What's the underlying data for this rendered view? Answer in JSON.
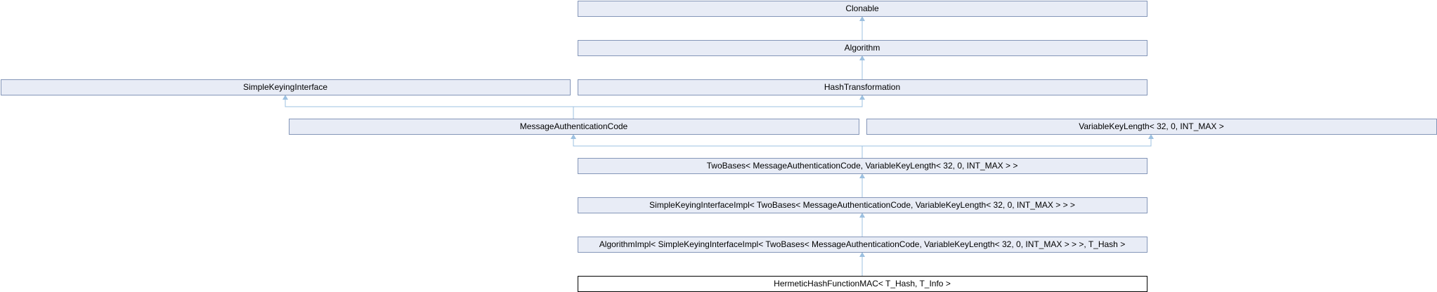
{
  "diagram": {
    "type": "class-inheritance-graph",
    "colors": {
      "base_fill": "#e8ecf6",
      "base_border": "#8496b8",
      "leaf_fill": "#ffffff",
      "leaf_border": "#000000",
      "edge": "#9cc0e0"
    },
    "nodes": [
      {
        "id": "clonable",
        "label": "Clonable",
        "kind": "base"
      },
      {
        "id": "algorithm",
        "label": "Algorithm",
        "kind": "base"
      },
      {
        "id": "simple-keying-interface",
        "label": "SimpleKeyingInterface",
        "kind": "base"
      },
      {
        "id": "hash-transformation",
        "label": "HashTransformation",
        "kind": "base"
      },
      {
        "id": "message-authentication-code",
        "label": "MessageAuthenticationCode",
        "kind": "base"
      },
      {
        "id": "variable-key-length",
        "label": "VariableKeyLength< 32, 0, INT_MAX >",
        "kind": "base"
      },
      {
        "id": "two-bases",
        "label": "TwoBases< MessageAuthenticationCode, VariableKeyLength< 32, 0, INT_MAX > >",
        "kind": "base"
      },
      {
        "id": "simple-keying-interface-impl",
        "label": "SimpleKeyingInterfaceImpl< TwoBases< MessageAuthenticationCode, VariableKeyLength< 32, 0, INT_MAX > > >",
        "kind": "base"
      },
      {
        "id": "algorithm-impl",
        "label": "AlgorithmImpl< SimpleKeyingInterfaceImpl< TwoBases< MessageAuthenticationCode, VariableKeyLength< 32, 0, INT_MAX > > >, T_Hash >",
        "kind": "base"
      },
      {
        "id": "hermetic-hash-function-mac",
        "label": "HermeticHashFunctionMAC< T_Hash, T_Info >",
        "kind": "leaf"
      }
    ],
    "edges": [
      {
        "from": "algorithm",
        "to": "clonable"
      },
      {
        "from": "hash-transformation",
        "to": "algorithm"
      },
      {
        "from": "message-authentication-code",
        "to": "simple-keying-interface"
      },
      {
        "from": "message-authentication-code",
        "to": "hash-transformation"
      },
      {
        "from": "two-bases",
        "to": "message-authentication-code"
      },
      {
        "from": "two-bases",
        "to": "variable-key-length"
      },
      {
        "from": "simple-keying-interface-impl",
        "to": "two-bases"
      },
      {
        "from": "algorithm-impl",
        "to": "simple-keying-interface-impl"
      },
      {
        "from": "hermetic-hash-function-mac",
        "to": "algorithm-impl"
      }
    ]
  }
}
